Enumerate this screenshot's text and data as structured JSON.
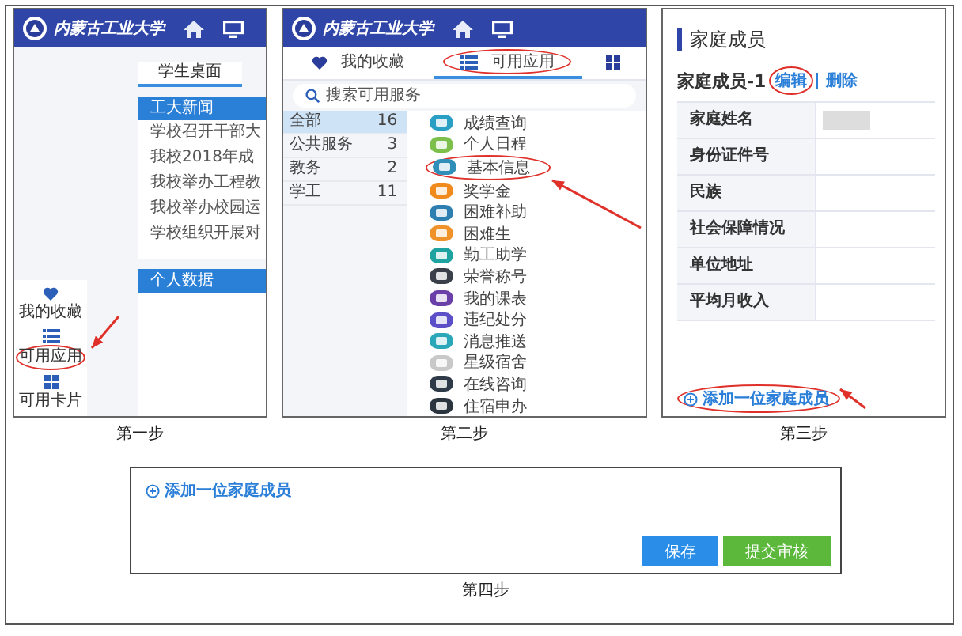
{
  "steps": [
    {
      "kind": "desktop",
      "caption": "第一步",
      "logo_text": "内蒙古工业大学",
      "tab": "学生桌面",
      "news": {
        "title": "工大新闻",
        "items": [
          "学校召开干部大",
          "我校2018年成",
          "我校举办工程教",
          "我校举办校园运",
          "学校组织开展对"
        ]
      },
      "data_card": {
        "title": "个人数据"
      },
      "side_nav": [
        {
          "label": "我的收藏",
          "highlighted": false
        },
        {
          "label": "可用应用",
          "highlighted": true
        },
        {
          "label": "可用卡片",
          "highlighted": false
        }
      ]
    },
    {
      "kind": "apps",
      "caption": "第二步",
      "logo_text": "内蒙古工业大学",
      "tabs": [
        {
          "label": "我的收藏",
          "selected": false,
          "highlighted": false
        },
        {
          "label": "可用应用",
          "selected": true,
          "highlighted": true
        },
        {
          "selected": false,
          "highlighted": false
        }
      ],
      "search": {
        "placeholder": "搜索可用服务"
      },
      "categories": [
        {
          "label": "全部",
          "count": "16",
          "selected": true
        },
        {
          "label": "公共服务",
          "count": "3",
          "selected": false
        },
        {
          "label": "教务",
          "count": "2",
          "selected": false
        },
        {
          "label": "学工",
          "count": "11",
          "selected": false
        }
      ],
      "apps": [
        {
          "label": "成绩查询",
          "color": "#2a9fc4",
          "highlighted": false
        },
        {
          "label": "个人日程",
          "color": "#7cc04b",
          "highlighted": false
        },
        {
          "label": "基本信息",
          "color": "#2f8fb8",
          "highlighted": true
        },
        {
          "label": "奖学金",
          "color": "#f08a1c",
          "highlighted": false
        },
        {
          "label": "困难补助",
          "color": "#2c7fb0",
          "highlighted": false
        },
        {
          "label": "困难生",
          "color": "#f0922a",
          "highlighted": false
        },
        {
          "label": "勤工助学",
          "color": "#1fa3a0",
          "highlighted": false
        },
        {
          "label": "荣誉称号",
          "color": "#3a3f4a",
          "highlighted": false
        },
        {
          "label": "我的课表",
          "color": "#6a3fa8",
          "highlighted": false
        },
        {
          "label": "违纪处分",
          "color": "#5b4fc8",
          "highlighted": false
        },
        {
          "label": "消息推送",
          "color": "#2aa7b8",
          "highlighted": false
        },
        {
          "label": "星级宿舍",
          "color": "#c8c8c8",
          "highlighted": false
        },
        {
          "label": "在线咨询",
          "color": "#2e3a48",
          "highlighted": false
        },
        {
          "label": "住宿申办",
          "color": "#2b3540",
          "highlighted": false
        }
      ]
    },
    {
      "kind": "family",
      "caption": "第三步",
      "title": "家庭成员",
      "member": "家庭成员-1",
      "edit": {
        "label": "编辑",
        "highlighted": true
      },
      "delete": "删除",
      "fields": [
        {
          "label": "家庭姓名",
          "redacted": true
        },
        {
          "label": "身份证件号",
          "redacted": false
        },
        {
          "label": "民族",
          "redacted": false
        },
        {
          "label": "社会保障情况",
          "redacted": false
        },
        {
          "label": "单位地址",
          "redacted": false
        },
        {
          "label": "平均月收入",
          "redacted": false
        }
      ],
      "add_link": {
        "label": "添加一位家庭成员",
        "highlighted": true
      }
    },
    {
      "kind": "form",
      "caption": "第四步",
      "add_link": {
        "label": "添加一位家庭成员",
        "highlighted": false
      },
      "buttons": [
        {
          "label": "保存",
          "kind": "primary"
        },
        {
          "label": "提交审核",
          "kind": "submit"
        }
      ]
    }
  ]
}
